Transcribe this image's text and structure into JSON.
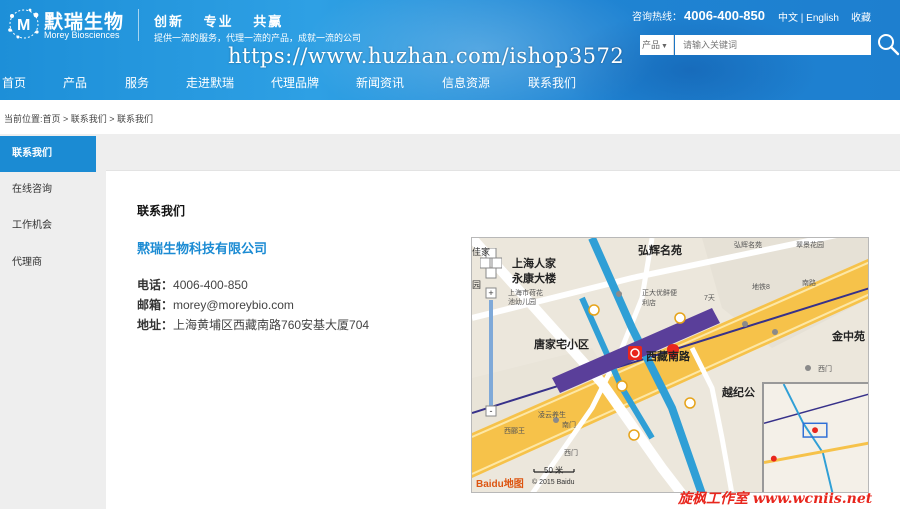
{
  "header": {
    "brand_cn": "默瑞生物",
    "brand_en": "Morey Biosciences",
    "slogan": "创新  专业  共赢",
    "slogan_sub": "提供一流的服务，代理一流的产品，成就一流的公司",
    "hotline_label": "咨询热线：",
    "hotline_number": "4006-400-850",
    "lang": "中文 | English",
    "favorite": "收藏",
    "search_category": "产品",
    "search_placeholder": "请输入关键词",
    "watermark": "https://www.huzhan.com/ishop3572"
  },
  "nav": {
    "items": [
      "首页",
      "产品",
      "服务",
      "走进默瑞",
      "代理品牌",
      "新闻资讯",
      "信息资源",
      "联系我们"
    ]
  },
  "breadcrumb": "当前位置:首页 > 联系我们 > 联系我们",
  "sidebar": {
    "items": [
      "联系我们",
      "在线咨询",
      "工作机会",
      "代理商"
    ]
  },
  "main": {
    "section_title": "联系我们",
    "company_name": "黙瑞生物科技有限公司",
    "phone_label": "电话：",
    "phone": "4006-400-850",
    "email_label": "邮箱：",
    "email": "morey@moreybio.com",
    "address_label": "地址：",
    "address": "上海黄埔区西藏南路760安基大厦704"
  },
  "map": {
    "labels": {
      "shanghai_renjia": "上海人家",
      "yongkang_dalou": "永康大楼",
      "hehua_chi": "上海市荷花",
      "hehua_chi2": "池幼儿园",
      "huihui_mingyuan": "弘辉名苑",
      "huihui_mingyuan_small": "弘辉名苑",
      "cuijing": "翠景花园",
      "zhengda": "正大优鲜便",
      "zhengda2": "利店",
      "seven": "7天",
      "jinzhongyuan": "金中苑",
      "tangjiazhai": "唐家宅小区",
      "xizangnanlu": "西藏南路",
      "lingyun": "凌云养生",
      "yuejiyuan": "越纪公",
      "ximen": "西门",
      "ximen2": "西门",
      "nanmen": "南门",
      "xiyuanwang": "西郦王",
      "jiajia": "佳家",
      "yuan": "园",
      "line8": "地铁8",
      "nanlu": "南路",
      "scale": "50 米",
      "baidu": "Baidu地图",
      "copyright": "© 2015 Baidu"
    }
  },
  "watermark_bottom": "旋枫工作室  www.wcniis.net",
  "colors": {
    "header_blue": "#1f8fd8",
    "accent_blue": "#1b8bd3",
    "sidebar_gray": "#eeeeee",
    "road_orange": "#f6b93b",
    "metro_blue": "#2f9fd6",
    "metro_purple": "#5a3f9a",
    "marker_red": "#e8261d"
  },
  "icons": {
    "search": "search-icon",
    "logo": "molecule-logo-icon"
  }
}
